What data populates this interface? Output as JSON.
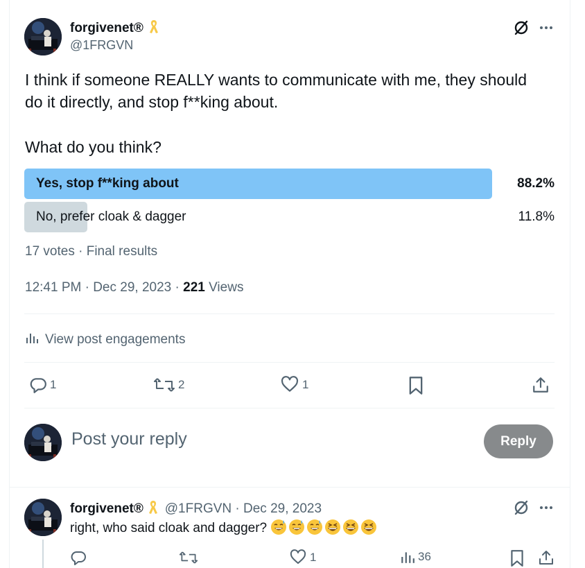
{
  "post": {
    "author_name": "forgivenet®",
    "author_badge_icon": "ribbon-icon",
    "handle": "@1FRGVN",
    "text_line1": "I think if someone REALLY wants to communicate with me, they should",
    "text_line2": "do it directly, and stop f**king about.",
    "text_line3": "What do you think?",
    "poll": {
      "options": [
        {
          "label": "Yes, stop f**king about",
          "percent": "88.2%",
          "fraction": 0.882,
          "winner": true
        },
        {
          "label": "No, prefer cloak & dagger",
          "percent": "11.8%",
          "fraction": 0.118,
          "winner": false
        }
      ],
      "summary": "17 votes · Final results"
    },
    "timestamp": "12:41 PM · Dec 29, 2023 · ",
    "views_count": "221",
    "views_label": " Views",
    "engagements_label": "View post engagements",
    "actions": {
      "replies": "1",
      "reposts": "2",
      "likes": "1"
    }
  },
  "composer": {
    "placeholder": "Post your reply",
    "reply_button": "Reply"
  },
  "reply": {
    "author_name": "forgivenet®",
    "handle_date": "@1FRGVN · Dec 29, 2023",
    "text": "right, who said cloak and dagger?",
    "emojis": [
      "sweat-smile",
      "sweat-smile",
      "sweat-smile",
      "laughing",
      "laughing",
      "laughing"
    ],
    "actions": {
      "replies": "",
      "reposts": "",
      "likes": "1",
      "views": "36"
    }
  },
  "colors": {
    "winner_bar": "#7fc4f7",
    "loser_bar": "#cfd9de",
    "badge": "#f7c948",
    "muted": "#536471"
  }
}
